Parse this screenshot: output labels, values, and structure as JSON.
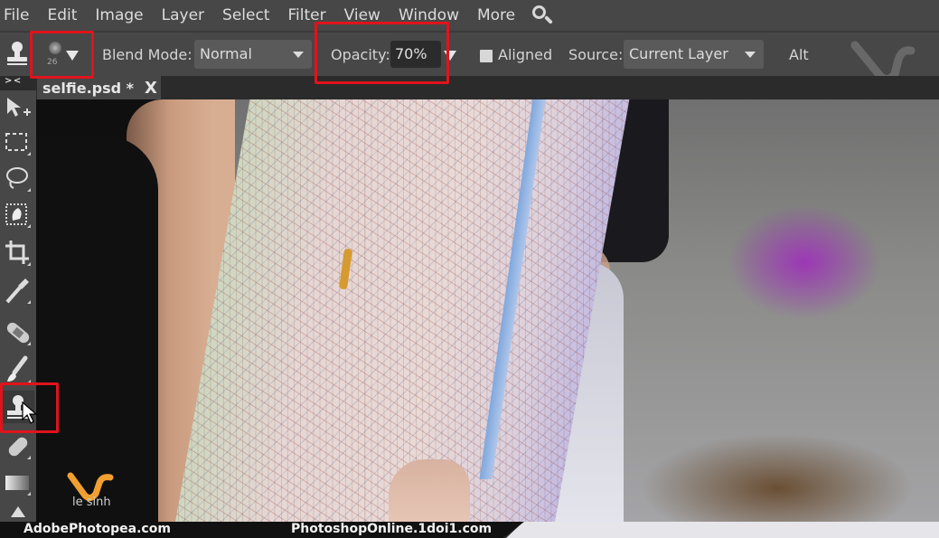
{
  "menubar": {
    "items": [
      "File",
      "Edit",
      "Image",
      "Layer",
      "Select",
      "Filter",
      "View",
      "Window",
      "More"
    ],
    "search_icon": "search-icon"
  },
  "options": {
    "tool_icon": "clone-stamp-icon",
    "brush_size": "26",
    "blend_mode_label": "Blend Mode:",
    "blend_mode_value": "Normal",
    "opacity_label": "Opacity:",
    "opacity_value": "70%",
    "aligned_label": "Aligned",
    "aligned_checked": false,
    "source_label": "Source:",
    "source_value": "Current Layer",
    "alt_label": "Alt"
  },
  "tabs": {
    "collapse_label": "> <",
    "document": {
      "name": "selfie.psd *",
      "close": "X"
    }
  },
  "toolbar": {
    "tools": [
      {
        "name": "move-tool",
        "icon": "move-icon"
      },
      {
        "name": "marquee-tool",
        "icon": "rect-select-icon"
      },
      {
        "name": "lasso-tool",
        "icon": "lasso-icon"
      },
      {
        "name": "quick-select-tool",
        "icon": "quick-select-icon"
      },
      {
        "name": "crop-tool",
        "icon": "crop-icon"
      },
      {
        "name": "eyedropper-tool",
        "icon": "eyedropper-icon"
      },
      {
        "name": "healing-tool",
        "icon": "bandage-icon"
      },
      {
        "name": "brush-tool",
        "icon": "brush-icon"
      },
      {
        "name": "clone-stamp-tool",
        "icon": "clone-stamp-icon",
        "active": true
      },
      {
        "name": "eraser-tool",
        "icon": "eraser-icon"
      },
      {
        "name": "gradient-tool",
        "icon": "gradient-icon"
      },
      {
        "name": "fill-tool",
        "icon": "bucket-icon"
      }
    ]
  },
  "watermark": {
    "text": "le sinh"
  },
  "footer": {
    "left": "AdobePhotopea.com",
    "right": "PhotoshopOnline.1doi1.com"
  },
  "colors": {
    "panel": "#474747",
    "highlight": "#e0131c",
    "watermark_orange": "#f0a030"
  }
}
